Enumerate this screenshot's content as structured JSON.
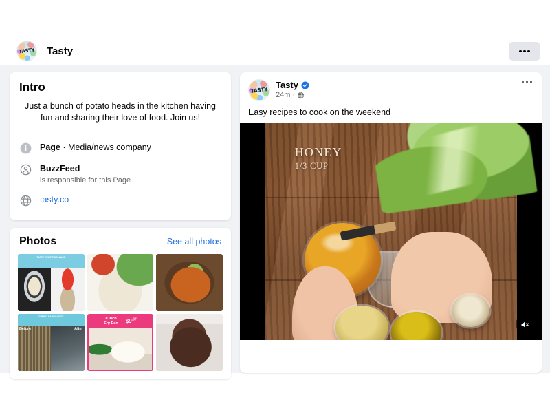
{
  "header": {
    "page_name": "Tasty",
    "avatar_label": "TASTY",
    "more_button_label": "More options"
  },
  "intro": {
    "title": "Intro",
    "bio": "Just a bunch of potato heads in the kitchen having fun and sharing their love of food. Join us!",
    "rows": [
      {
        "icon": "info-icon",
        "bold": "Page",
        "text": " · Media/news company",
        "sub": ""
      },
      {
        "icon": "account-check-icon",
        "bold": "BuzzFeed",
        "text": "",
        "sub": "is responsible for this Page"
      },
      {
        "icon": "globe-icon",
        "bold": "",
        "text": "tasty.co",
        "sub": "",
        "is_link": true
      }
    ]
  },
  "photos": {
    "title": "Photos",
    "see_all_label": "See all photos",
    "items": [
      {
        "name": "photo-recipe-collage",
        "caption": "TASTY RECIPE COLLAGE",
        "label_top": "",
        "label_bottom": ""
      },
      {
        "name": "photo-chicken-parmesan",
        "caption": "",
        "label_top": "",
        "label_bottom": ""
      },
      {
        "name": "photo-beef-noodle-stew",
        "caption": "",
        "label_top": "",
        "label_bottom": ""
      },
      {
        "name": "photo-oven-before-after",
        "caption": "OVEN CLEANING HACK",
        "label_top": "Before",
        "label_bottom": "After"
      },
      {
        "name": "photo-fry-pan-ad",
        "caption": "",
        "product_name": "8 inch\nFry Pan",
        "price_main": "$9",
        "price_cents": ".97"
      },
      {
        "name": "photo-chocolate-cake",
        "caption": "",
        "label_top": "",
        "label_bottom": ""
      }
    ]
  },
  "post": {
    "author": "Tasty",
    "avatar_label": "TASTY",
    "verified": true,
    "timestamp": "24m",
    "audience_icon": "globe-icon",
    "separator": "·",
    "text": "Easy recipes to cook on the weekend",
    "more_button_label": "More options",
    "video": {
      "overlay_title": "HONEY",
      "overlay_amount": "1/3 CUP",
      "mute_icon": "speaker-mute-icon",
      "muted": true
    }
  },
  "colors": {
    "page_background": "#f0f2f5",
    "card_background": "#ffffff",
    "link": "#216fdb",
    "verified_blue": "#1b74e4",
    "text_primary": "#050505",
    "text_secondary": "#65676b",
    "ad_pink": "#ec3a7e"
  }
}
